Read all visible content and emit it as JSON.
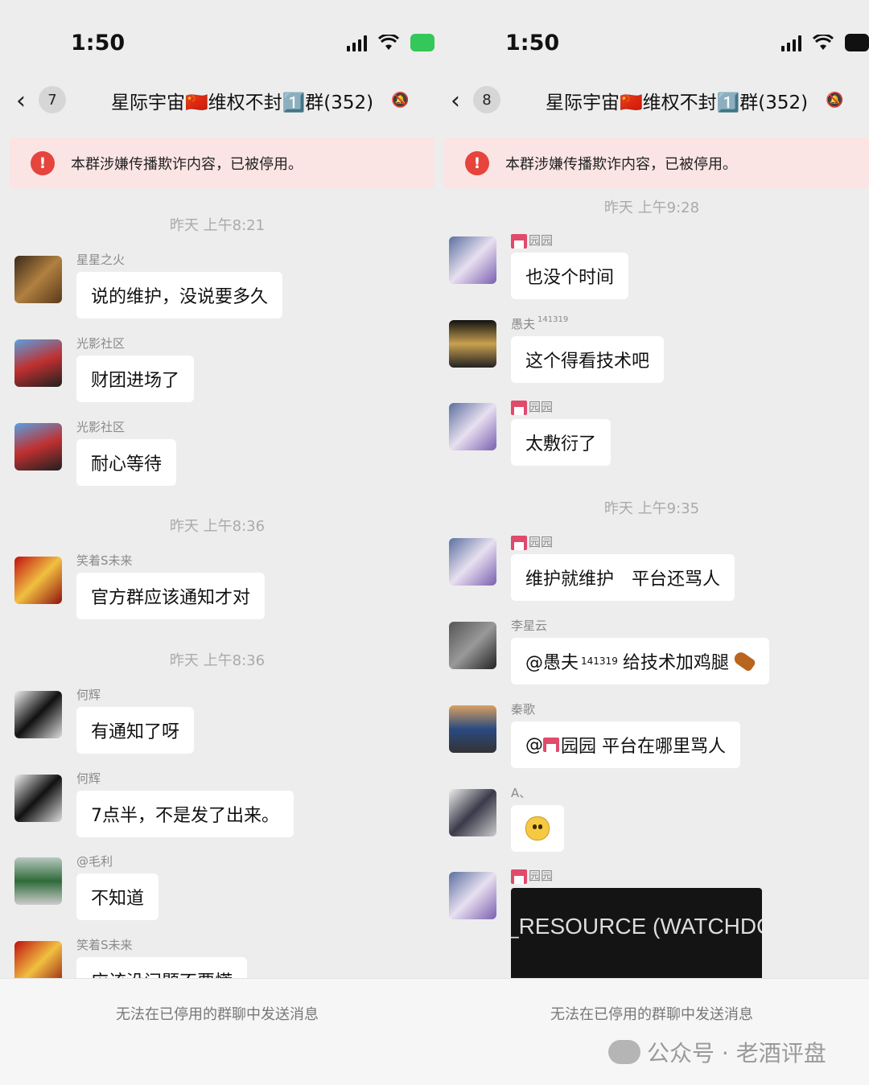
{
  "left": {
    "time": "1:50",
    "back_count": "7",
    "title": "星际宇宙🇨🇳维权不封1️⃣群(352)",
    "banner": "本群涉嫌传播欺诈内容，已被停用。",
    "timestamps": [
      "昨天 上午8:21",
      "昨天 上午8:36",
      "昨天 上午8:36"
    ],
    "messages": [
      {
        "sender": "星星之火",
        "text": "说的维护，没说要多久"
      },
      {
        "sender": "光影社区",
        "text": "财团进场了"
      },
      {
        "sender": "光影社区",
        "text": "耐心等待"
      },
      {
        "sender": "笑着S未来",
        "text": "官方群应该通知才对"
      },
      {
        "sender": "何辉",
        "text": "有通知了呀"
      },
      {
        "sender": "何辉",
        "text": "7点半，不是发了出来。"
      },
      {
        "sender": "@毛利",
        "text": "不知道"
      },
      {
        "sender": "笑着S未来",
        "text": "应该没问题不要慌"
      }
    ],
    "footer": "无法在已停用的群聊中发送消息"
  },
  "right": {
    "time": "1:50",
    "back_count": "8",
    "title": "星际宇宙🇨🇳维权不封1️⃣群(352)",
    "banner": "本群涉嫌传播欺诈内容，已被停用。",
    "timestamps": [
      "昨天 上午9:28",
      "昨天 上午9:35"
    ],
    "messages": [
      {
        "sender": "园园",
        "text": "也没个时间"
      },
      {
        "sender": "愚夫",
        "sender_sup": "141319",
        "text": "这个得看技术吧"
      },
      {
        "sender": "园园",
        "text": "太敷衍了"
      },
      {
        "sender": "园园",
        "text": "维护就维护　平台还骂人"
      },
      {
        "sender": "李星云",
        "text_prefix": "@愚夫",
        "text_sup": "141319",
        "text": "给技术加鸡腿"
      },
      {
        "sender": "秦歌",
        "text_prefix": "@",
        "text": "园园 平台在哪里骂人"
      },
      {
        "sender": "A、",
        "text": ""
      },
      {
        "sender": "园园",
        "text": "_RESOURCE (WATCHDO"
      }
    ],
    "footer": "无法在已停用的群聊中发送消息"
  },
  "watermark": "公众号 · 老酒评盘",
  "colors": {
    "warning": "#e5453c",
    "banner_bg": "#fbe4e4",
    "chat_bg": "#ededed",
    "bubble": "#ffffff",
    "battery": "#34c759"
  },
  "icons": [
    "back-chevron-icon",
    "mute-bell-icon",
    "warning-icon",
    "signal-icon",
    "wifi-icon",
    "battery-icon",
    "wechat-icon",
    "house-emoji-icon",
    "drumstick-emoji-icon",
    "pleading-face-emoji-icon"
  ]
}
